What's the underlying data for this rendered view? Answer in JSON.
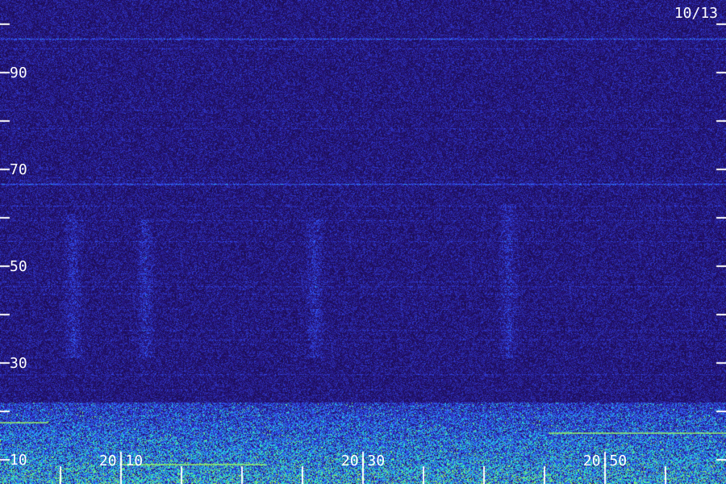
{
  "date_label": "10/13",
  "chart_data": {
    "type": "heatmap",
    "title": "",
    "xlabel": "",
    "ylabel": "",
    "x_tick_labels": [
      "20:10",
      "20:30",
      "20:50"
    ],
    "y_tick_labels": [
      "90",
      "70",
      "50",
      "30",
      "10"
    ],
    "y_tick_values": [
      90,
      70,
      50,
      30,
      10
    ],
    "ylim": [
      5,
      100
    ],
    "colors": {
      "background": "#1a0d4a",
      "low": "#2a14a0",
      "mid": "#3a48ff",
      "high": "#40e8c8",
      "peak": "#a0ff60",
      "ticks": "#ffffff"
    },
    "features": [
      {
        "kind": "horizontal-band",
        "y": 97
      },
      {
        "kind": "horizontal-band",
        "y": 67
      },
      {
        "kind": "vertical-burst",
        "x": "20:06",
        "y_range": [
          31,
          61
        ]
      },
      {
        "kind": "vertical-burst",
        "x": "20:12",
        "y_range": [
          31,
          60
        ]
      },
      {
        "kind": "vertical-burst",
        "x": "20:26",
        "y_range": [
          31,
          60
        ]
      },
      {
        "kind": "vertical-burst",
        "x": "20:42",
        "y_range": [
          31,
          63
        ]
      },
      {
        "kind": "broadband-noise",
        "y_range": [
          5,
          22
        ]
      }
    ]
  }
}
